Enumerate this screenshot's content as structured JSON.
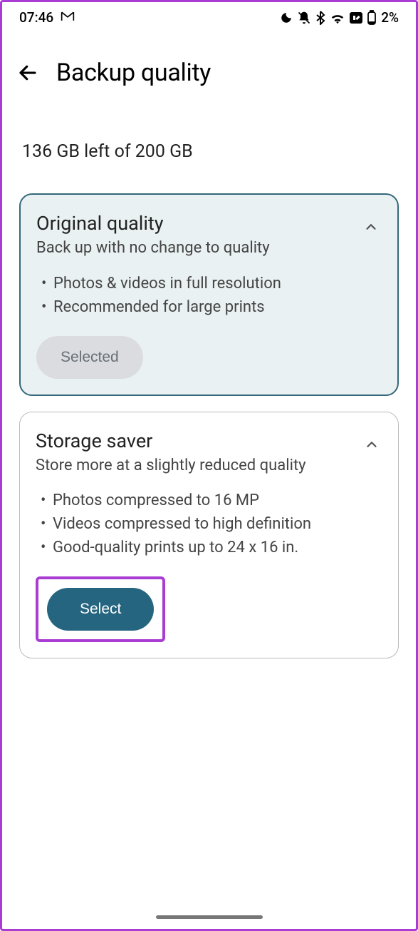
{
  "status_bar": {
    "time": "07:46",
    "battery_percent": "2%"
  },
  "header": {
    "title": "Backup quality"
  },
  "storage": {
    "summary": "136 GB left of 200 GB"
  },
  "cards": {
    "original": {
      "title": "Original quality",
      "subtitle": "Back up with no change to quality",
      "bullets": [
        "Photos & videos in full resolution",
        "Recommended for large prints"
      ],
      "button_label": "Selected"
    },
    "saver": {
      "title": "Storage saver",
      "subtitle": "Store more at a slightly reduced quality",
      "bullets": [
        "Photos compressed to 16 MP",
        "Videos compressed to high definition",
        "Good-quality prints up to 24 x 16 in."
      ],
      "button_label": "Select"
    }
  }
}
